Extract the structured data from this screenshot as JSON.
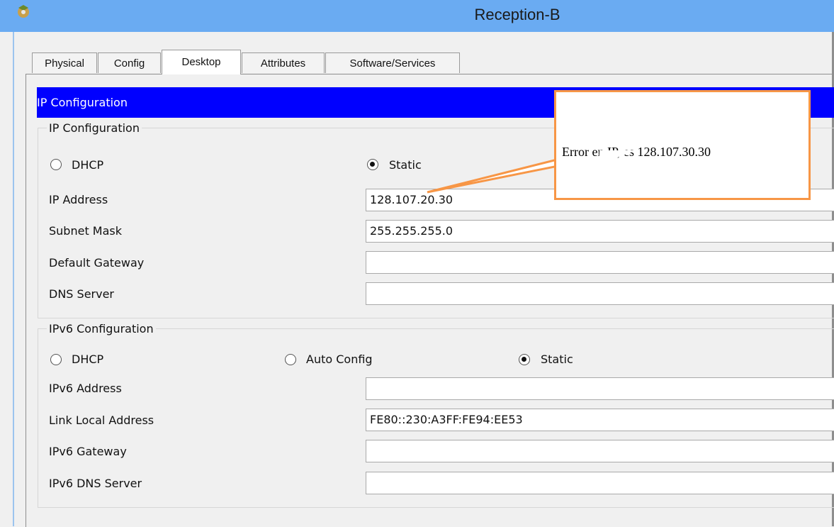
{
  "window": {
    "title": "Reception-B",
    "app_icon": "packet-tracer-icon"
  },
  "tabs": [
    "Physical",
    "Config",
    "Desktop",
    "Attributes",
    "Software/Services"
  ],
  "active_tab": "Desktop",
  "panel": {
    "header": "IP Configuration"
  },
  "ipv4": {
    "legend": "IP Configuration",
    "dhcp_label": "DHCP",
    "static_label": "Static",
    "mode": "Static",
    "fields": {
      "ip_address": {
        "label": "IP Address",
        "value": "128.107.20.30"
      },
      "subnet_mask": {
        "label": "Subnet Mask",
        "value": "255.255.255.0"
      },
      "default_gateway": {
        "label": "Default Gateway",
        "value": ""
      },
      "dns_server": {
        "label": "DNS Server",
        "value": ""
      }
    }
  },
  "ipv6": {
    "legend": "IPv6 Configuration",
    "dhcp_label": "DHCP",
    "auto_label": "Auto Config",
    "static_label": "Static",
    "mode": "Static",
    "fields": {
      "ipv6_address": {
        "label": "IPv6 Address",
        "value": ""
      },
      "link_local": {
        "label": "Link Local Address",
        "value": "FE80::230:A3FF:FE94:EE53"
      },
      "ipv6_gateway": {
        "label": "IPv6 Gateway",
        "value": ""
      },
      "ipv6_dns": {
        "label": "IPv6 DNS Server",
        "value": ""
      }
    }
  },
  "annotation": {
    "text": "Error en IP, es 128.107.30.30",
    "border_color": "#f79646"
  },
  "colors": {
    "titlebar": "#6aabf2",
    "header": "#0000ff"
  }
}
